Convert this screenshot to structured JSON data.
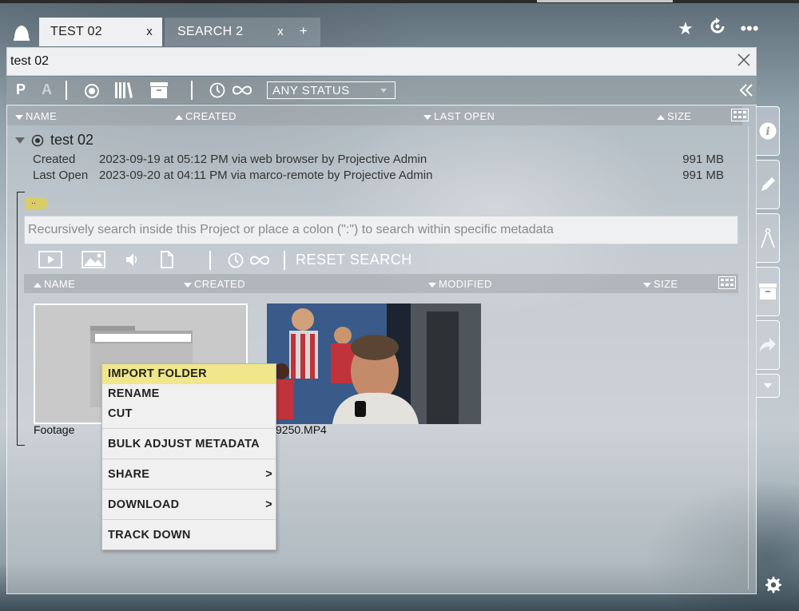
{
  "tabs": [
    {
      "label": "TEST 02",
      "close": "x"
    },
    {
      "label": "SEARCH 2",
      "close": "x"
    }
  ],
  "new_tab": "+",
  "search": {
    "value": "test 02"
  },
  "toolbar": {
    "p": "P",
    "a": "A",
    "status": "ANY STATUS"
  },
  "columns": {
    "name": "NAME",
    "created": "CREATED",
    "last_open": "LAST OPEN",
    "size": "SIZE"
  },
  "project": {
    "name": "test 02",
    "created_label": "Created",
    "created_value": "2023-09-19 at 05:12 PM via web browser by Projective Admin",
    "created_size": "991 MB",
    "lastopen_label": "Last Open",
    "lastopen_value": "2023-09-20 at 04:11 PM via marco-remote by Projective Admin",
    "lastopen_size": "991 MB"
  },
  "up_dir": "..",
  "inner_search": {
    "placeholder": "Recursively search inside this Project or place a colon (\":\") to search within specific metadata"
  },
  "inner_toolbar": {
    "reset": "RESET SEARCH"
  },
  "inner_columns": {
    "name": "NAME",
    "created": "CREATED",
    "modified": "MODIFIED",
    "size": "SIZE"
  },
  "items": [
    {
      "label": "Footage",
      "type": "folder"
    },
    {
      "label": "9250.MP4",
      "type": "video"
    }
  ],
  "context_menu": [
    {
      "label": "IMPORT FOLDER",
      "arrow": ""
    },
    {
      "label": "RENAME",
      "arrow": ""
    },
    {
      "label": "CUT",
      "arrow": ""
    },
    {
      "label": "BULK ADJUST METADATA",
      "arrow": ""
    },
    {
      "label": "SHARE",
      "arrow": ">"
    },
    {
      "label": "DOWNLOAD",
      "arrow": ">"
    },
    {
      "label": "TRACK DOWN",
      "arrow": ""
    }
  ],
  "colors": {
    "highlight": "#efe789",
    "updir": "#d8cd6a",
    "panel": "#eef0f2"
  }
}
